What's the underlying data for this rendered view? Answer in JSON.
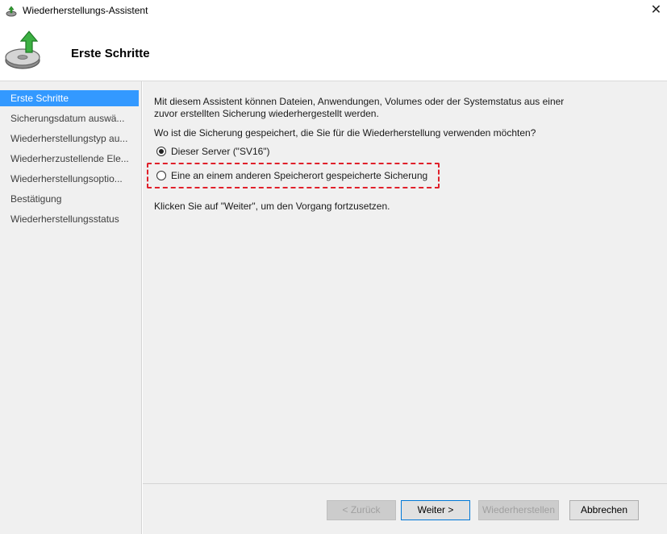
{
  "window": {
    "title": "Wiederherstellungs-Assistent",
    "close_glyph": "✕"
  },
  "header": {
    "title": "Erste Schritte",
    "icon": "backup-restore-icon"
  },
  "sidebar": {
    "items": [
      {
        "label": "Erste Schritte",
        "active": true
      },
      {
        "label": "Sicherungsdatum auswä...",
        "active": false
      },
      {
        "label": "Wiederherstellungstyp au...",
        "active": false
      },
      {
        "label": "Wiederherzustellende Ele...",
        "active": false
      },
      {
        "label": "Wiederherstellungsoptio...",
        "active": false
      },
      {
        "label": "Bestätigung",
        "active": false
      },
      {
        "label": "Wiederherstellungsstatus",
        "active": false
      }
    ]
  },
  "main": {
    "intro_line1": "Mit diesem Assistent können Dateien, Anwendungen, Volumes oder der Systemstatus aus einer",
    "intro_line2": "zuvor erstellten Sicherung wiederhergestellt werden.",
    "question": "Wo ist die Sicherung gespeichert, die Sie für die Wiederherstellung verwenden möchten?",
    "options": [
      {
        "label": "Dieser Server (\"SV16\")",
        "selected": true
      },
      {
        "label": "Eine an einem anderen Speicherort gespeicherte Sicherung",
        "selected": false
      }
    ],
    "continue_hint": "Klicken Sie auf \"Weiter\", um den Vorgang fortzusetzen."
  },
  "footer": {
    "back_label": "< Zurück",
    "next_label": "Weiter >",
    "restore_label": "Wiederherstellen",
    "cancel_label": "Abbrechen"
  },
  "colors": {
    "accent": "#3399ff",
    "highlight": "#e0202a"
  }
}
